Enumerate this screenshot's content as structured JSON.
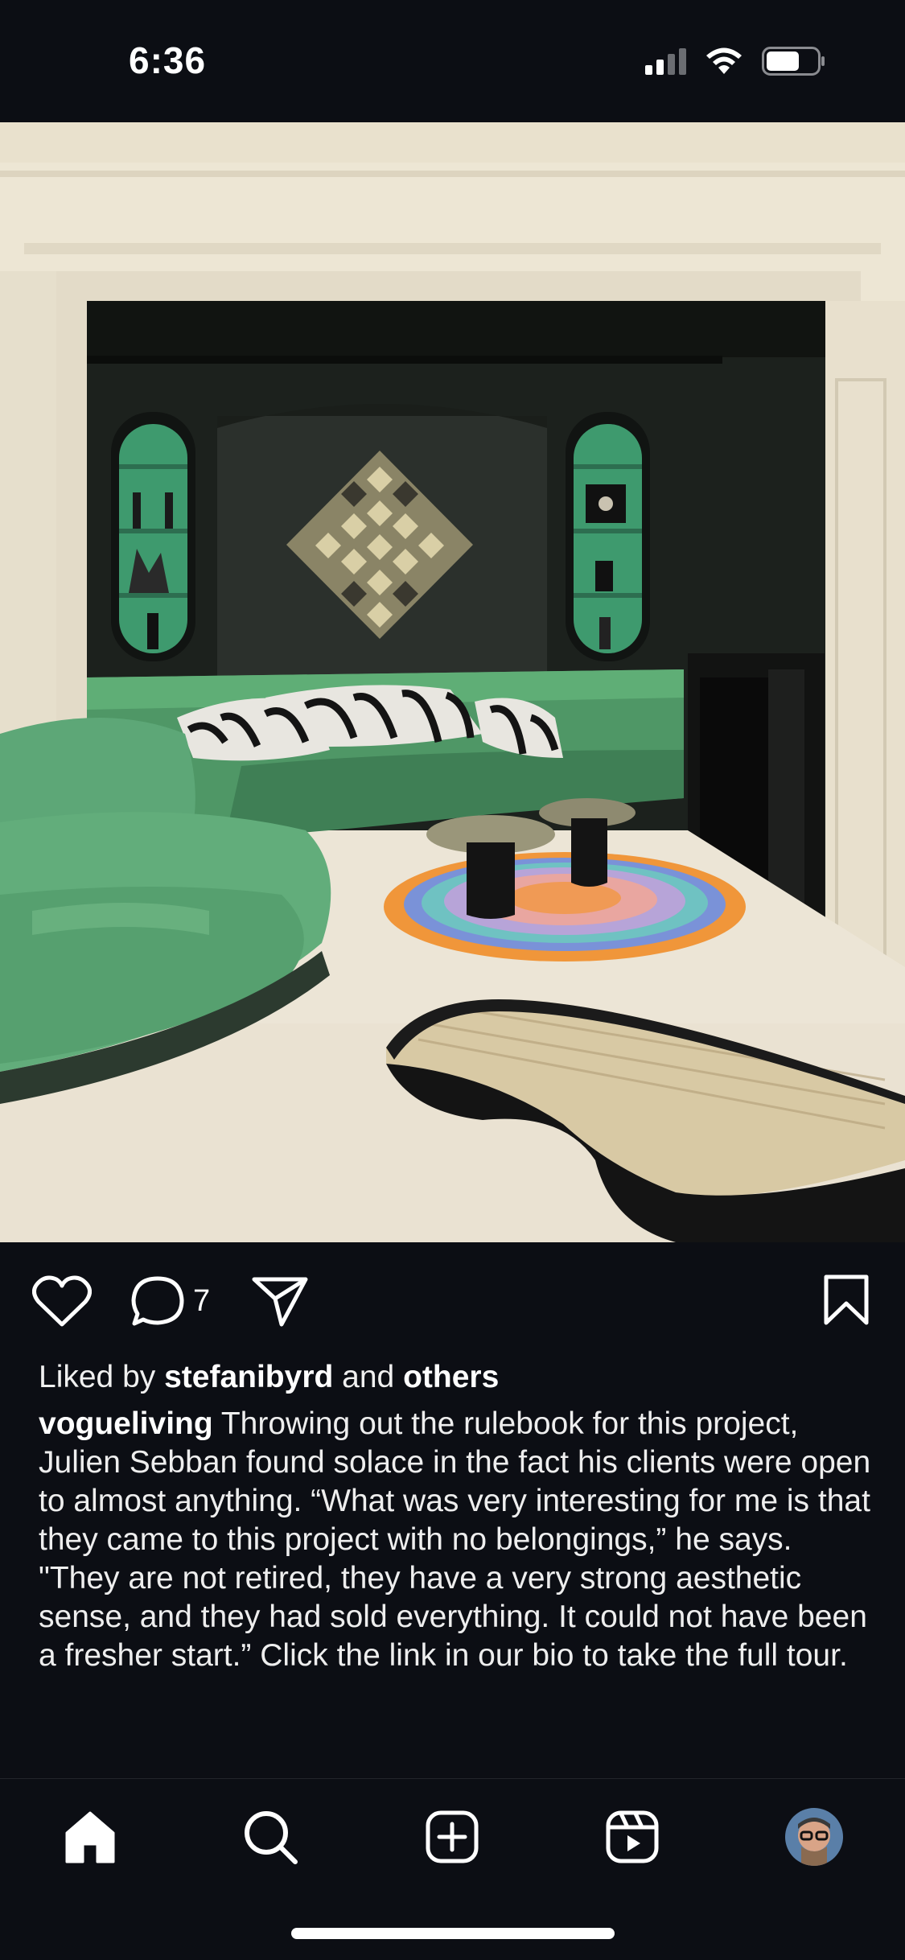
{
  "status_bar": {
    "time": "6:36"
  },
  "post": {
    "comment_count": "7",
    "likes": {
      "prefix": "Liked by",
      "user": "stefanibyrd",
      "joiner": "and",
      "others": "others"
    },
    "caption": {
      "author": "vogueliving",
      "text": "Throwing out the rulebook for this project, Julien Sebban found solace in the fact his clients were open to almost anything. “What was very interesting for me is that they came to this project with no belongings,” he says. \"They are not retired, they have a very strong aesthetic sense, and they had sold everything. It could not have been a fresher start.” Click the link in our bio to take the full tour."
    }
  },
  "icons": {
    "like": "heart-icon",
    "comment": "comment-bubble-icon",
    "share": "paper-plane-icon",
    "save": "bookmark-icon",
    "home": "home-icon",
    "search": "search-icon",
    "create": "plus-square-icon",
    "reels": "reels-icon"
  },
  "colors": {
    "background": "#0c0e14",
    "text": "#ffffff"
  }
}
